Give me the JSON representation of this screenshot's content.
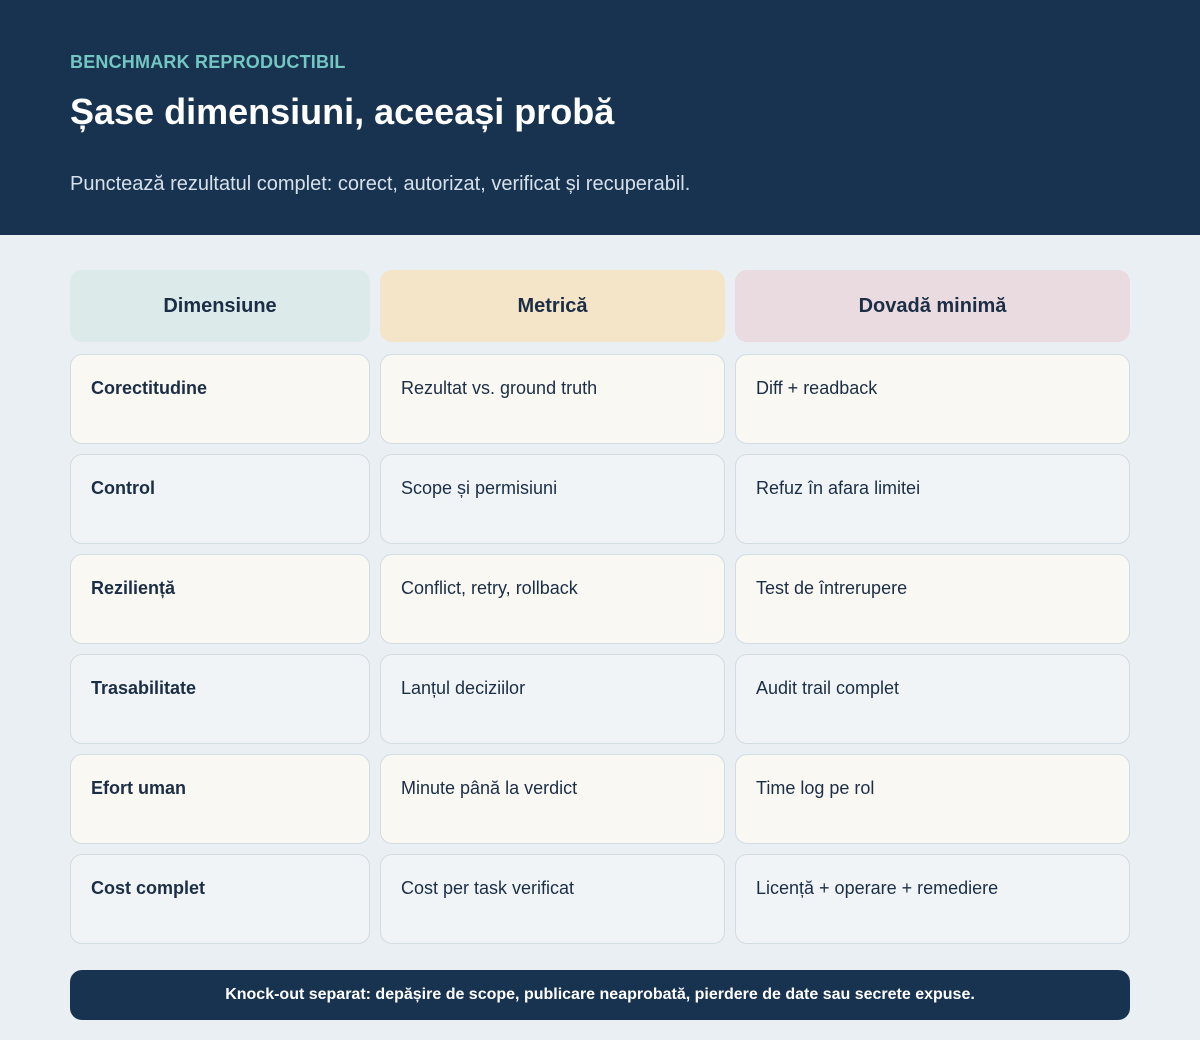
{
  "header": {
    "eyebrow": "BENCHMARK REPRODUCTIBIL",
    "title": "Șase dimensiuni, aceeași probă",
    "subtitle": "Punctează rezultatul complet: corect, autorizat, verificat și recuperabil."
  },
  "table": {
    "columns": [
      "Dimensiune",
      "Metrică",
      "Dovadă minimă"
    ],
    "column_colors": [
      "#dcebea",
      "#f4e4c8",
      "#eadbe0"
    ],
    "rows": [
      [
        "Corectitudine",
        "Rezultat vs. ground truth",
        "Diff + readback"
      ],
      [
        "Control",
        "Scope și permisiuni",
        "Refuz în afara limitei"
      ],
      [
        "Reziliență",
        "Conflict, retry, rollback",
        "Test de întrerupere"
      ],
      [
        "Trasabilitate",
        "Lanțul deciziilor",
        "Audit trail complet"
      ],
      [
        "Efort uman",
        "Minute până la verdict",
        "Time log pe rol"
      ],
      [
        "Cost complet",
        "Cost per task verificat",
        "Licență + operare + remediere"
      ]
    ]
  },
  "footer": {
    "note": "Knock-out separat: depășire de scope, publicare neaprobată, pierdere de date sau secrete expuse."
  },
  "colors": {
    "header_bg": "#183350",
    "accent": "#74c6c2",
    "page_bg": "#e9eff2"
  }
}
